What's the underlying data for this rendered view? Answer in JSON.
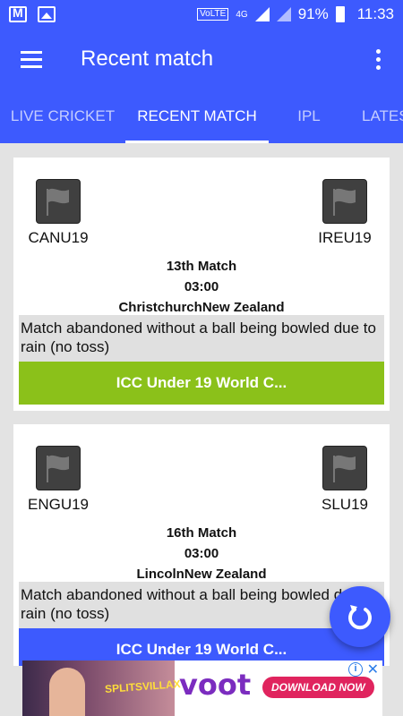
{
  "status_bar": {
    "volte": "VoLTE",
    "network": "4G",
    "battery_percent": "91%",
    "time": "11:33",
    "left_icons": [
      "gmail-icon",
      "photo-icon"
    ]
  },
  "app_bar": {
    "title": "Recent match"
  },
  "tabs": [
    {
      "label": "LIVE CRICKET",
      "active": false
    },
    {
      "label": "RECENT MATCH",
      "active": true
    },
    {
      "label": "IPL",
      "active": false
    },
    {
      "label": "LATES",
      "active": false
    }
  ],
  "matches": [
    {
      "team1": "CANU19",
      "team2": "IREU19",
      "match_no": "13th Match",
      "time": "03:00",
      "venue": "ChristchurchNew Zealand",
      "result": "Match abandoned without a ball being bowled due to rain (no toss)",
      "series": "ICC Under 19 World C...",
      "series_color": "#8bc11a"
    },
    {
      "team1": "ENGU19",
      "team2": "SLU19",
      "match_no": "16th Match",
      "time": "03:00",
      "venue": "LincolnNew Zealand",
      "result": "Match abandoned without a ball being bowled due to rain (no toss)",
      "series": "ICC Under 19 World C...",
      "series_color": "#3d5afe"
    }
  ],
  "ad": {
    "subtext": "SPLITSVILLAX",
    "brand": "voot",
    "cta": "DOWNLOAD NOW"
  },
  "colors": {
    "primary": "#3d5afe",
    "green_series": "#8bc11a",
    "background": "#e3e3e3"
  }
}
